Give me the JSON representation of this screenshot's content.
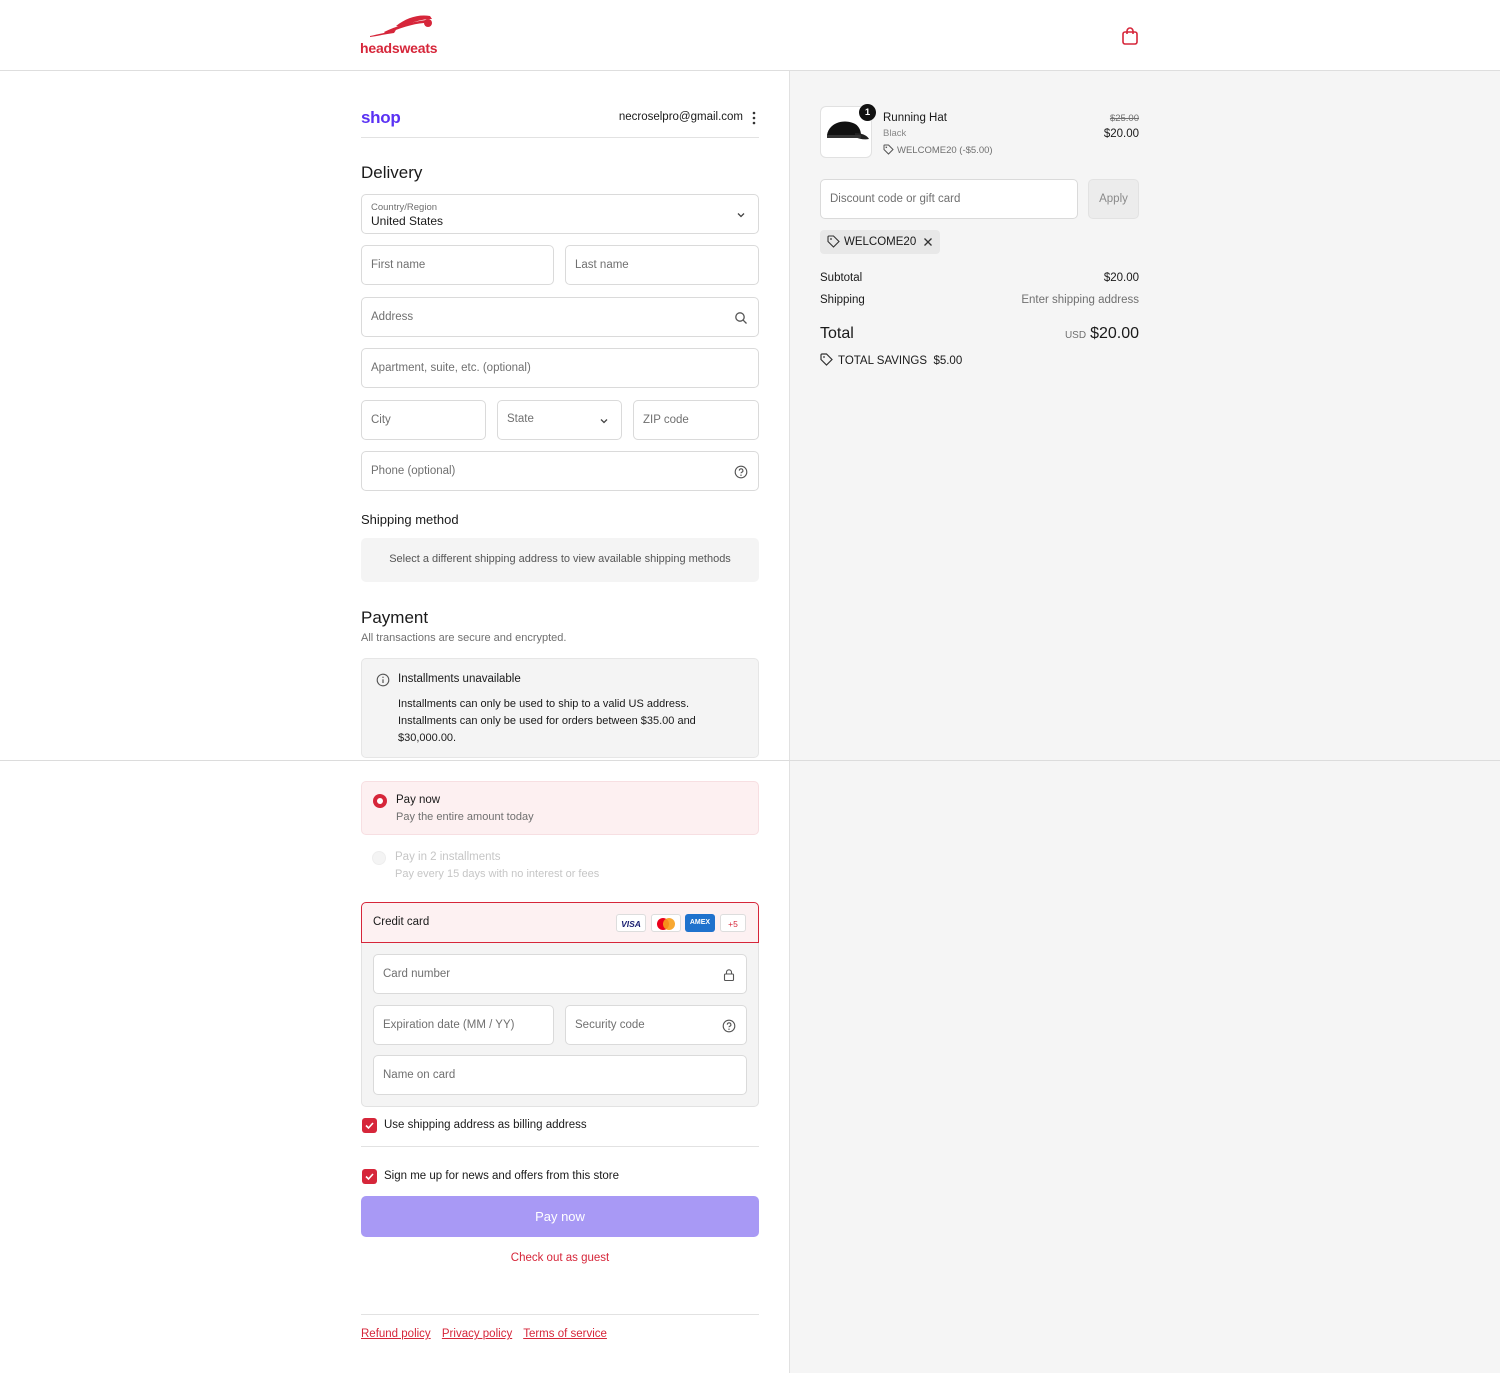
{
  "header": {
    "brand": "headsweats",
    "cart_icon": "shopping-bag-icon"
  },
  "account": {
    "shop_label": "shop",
    "email": "necroselpro@gmail.com"
  },
  "delivery": {
    "heading": "Delivery",
    "country_label": "Country/Region",
    "country_value": "United States",
    "first_name_ph": "First name",
    "last_name_ph": "Last name",
    "address_ph": "Address",
    "apt_ph": "Apartment, suite, etc. (optional)",
    "city_ph": "City",
    "state_ph": "State",
    "zip_ph": "ZIP code",
    "phone_ph": "Phone (optional)"
  },
  "shipping_method": {
    "heading": "Shipping method",
    "note": "Select a different shipping address to view available shipping methods"
  },
  "payment": {
    "heading": "Payment",
    "subtext": "All transactions are secure and encrypted.",
    "installments_title": "Installments unavailable",
    "installments_line1": "Installments can only be used to ship to a valid US address.",
    "installments_line2": "Installments can only be used for orders between $35.00 and $30,000.00.",
    "options": [
      {
        "title": "Pay now",
        "subtitle": "Pay the entire amount today",
        "selected": true
      },
      {
        "title": "Pay in 2 installments",
        "subtitle": "Pay every 15 days with no interest or fees",
        "selected": false
      }
    ],
    "credit_card_label": "Credit card",
    "card_brands": [
      "VISA",
      "mastercard",
      "AMEX",
      "+5"
    ],
    "card_number_ph": "Card number",
    "expiry_ph": "Expiration date (MM / YY)",
    "security_ph": "Security code",
    "name_ph": "Name on card",
    "billing_same": "Use shipping address as billing address",
    "newsletter": "Sign me up for news and offers from this store",
    "pay_button": "Pay now",
    "guest_link": "Check out as guest"
  },
  "footer": {
    "links": [
      "Refund policy",
      "Privacy policy",
      "Terms of service"
    ]
  },
  "summary": {
    "item": {
      "qty": "1",
      "name": "Running Hat",
      "variant": "Black",
      "discount": "WELCOME20 (-$5.00)",
      "old_price": "$25.00",
      "price": "$20.00"
    },
    "discount_ph": "Discount code or gift card",
    "apply_label": "Apply",
    "applied_code": "WELCOME20",
    "subtotal_label": "Subtotal",
    "subtotal_value": "$20.00",
    "shipping_label": "Shipping",
    "shipping_value": "Enter shipping address",
    "total_label": "Total",
    "total_currency": "USD",
    "total_value": "$20.00",
    "savings_label": "TOTAL SAVINGS",
    "savings_value": "$5.00"
  },
  "colors": {
    "brand_red": "#d6263a",
    "shop_purple": "#5a31f4",
    "pay_button": "#a899f5"
  }
}
